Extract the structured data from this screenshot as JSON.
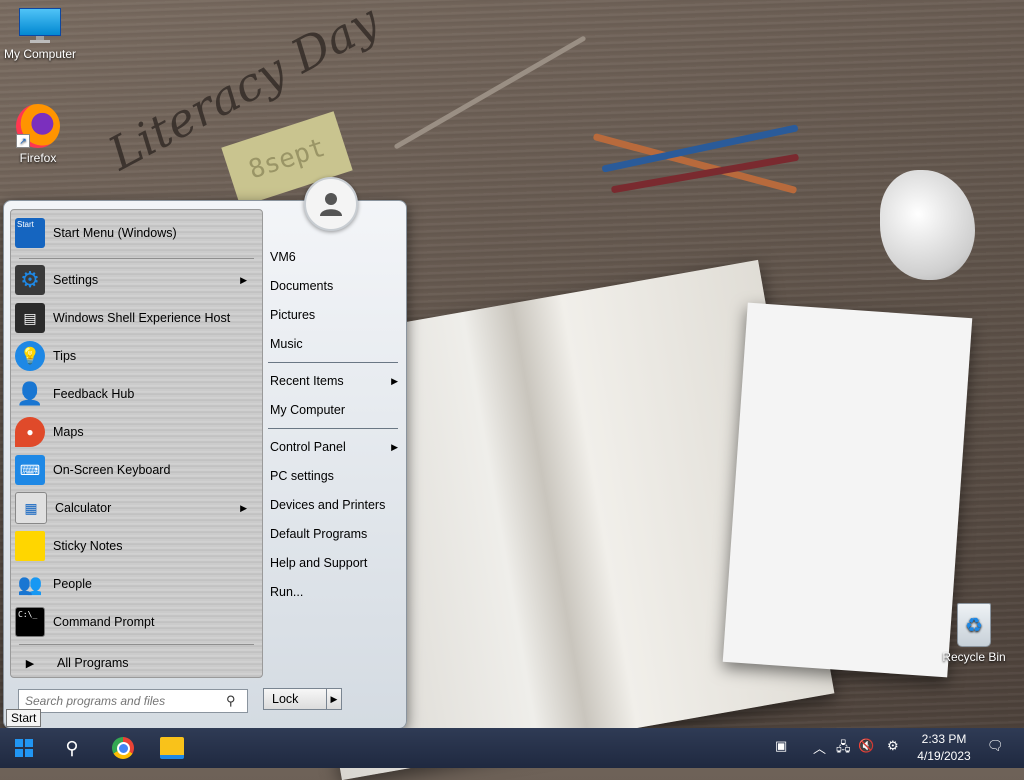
{
  "desktop": {
    "icons": [
      {
        "label": "My Computer",
        "icon": "monitor-icon"
      },
      {
        "label": "Firefox",
        "icon": "firefox-icon"
      },
      {
        "label": "Recycle Bin",
        "icon": "recycle-bin-icon"
      }
    ],
    "wallpaper_text": "Literacy Day",
    "wallpaper_note": "8sept"
  },
  "start_menu": {
    "programs": [
      {
        "label": "Start Menu (Windows)",
        "icon": "start-menu-icon",
        "submenu": false
      },
      {
        "label": "Settings",
        "icon": "gear-icon",
        "submenu": true
      },
      {
        "label": "Windows Shell Experience Host",
        "icon": "shell-host-icon",
        "submenu": false
      },
      {
        "label": "Tips",
        "icon": "lightbulb-icon",
        "submenu": false
      },
      {
        "label": "Feedback Hub",
        "icon": "feedback-icon",
        "submenu": false
      },
      {
        "label": "Maps",
        "icon": "map-pin-icon",
        "submenu": false
      },
      {
        "label": "On-Screen Keyboard",
        "icon": "keyboard-icon",
        "submenu": false
      },
      {
        "label": "Calculator",
        "icon": "calculator-icon",
        "submenu": true
      },
      {
        "label": "Sticky Notes",
        "icon": "sticky-note-icon",
        "submenu": false
      },
      {
        "label": "People",
        "icon": "people-icon",
        "submenu": false
      },
      {
        "label": "Command Prompt",
        "icon": "terminal-icon",
        "submenu": false
      }
    ],
    "all_programs": "All Programs",
    "start_icon_text": "Start",
    "right_items": [
      {
        "label": "VM6",
        "submenu": false
      },
      {
        "label": "Documents",
        "submenu": false
      },
      {
        "label": "Pictures",
        "submenu": false
      },
      {
        "label": "Music",
        "submenu": false
      },
      {
        "label": "Recent Items",
        "submenu": true
      },
      {
        "label": "My Computer",
        "submenu": false
      },
      {
        "label": "Control Panel",
        "submenu": true
      },
      {
        "label": "PC settings",
        "submenu": false
      },
      {
        "label": "Devices and Printers",
        "submenu": false
      },
      {
        "label": "Default Programs",
        "submenu": false
      },
      {
        "label": "Help and Support",
        "submenu": false
      },
      {
        "label": "Run...",
        "submenu": false
      }
    ],
    "search_placeholder": "Search programs and files",
    "lock_label": "Lock"
  },
  "tooltip": "Start",
  "taskbar": {
    "clock_time": "2:33 PM",
    "clock_date": "4/19/2023",
    "pinned": [
      "search-icon",
      "chrome-icon",
      "file-explorer-icon"
    ]
  }
}
